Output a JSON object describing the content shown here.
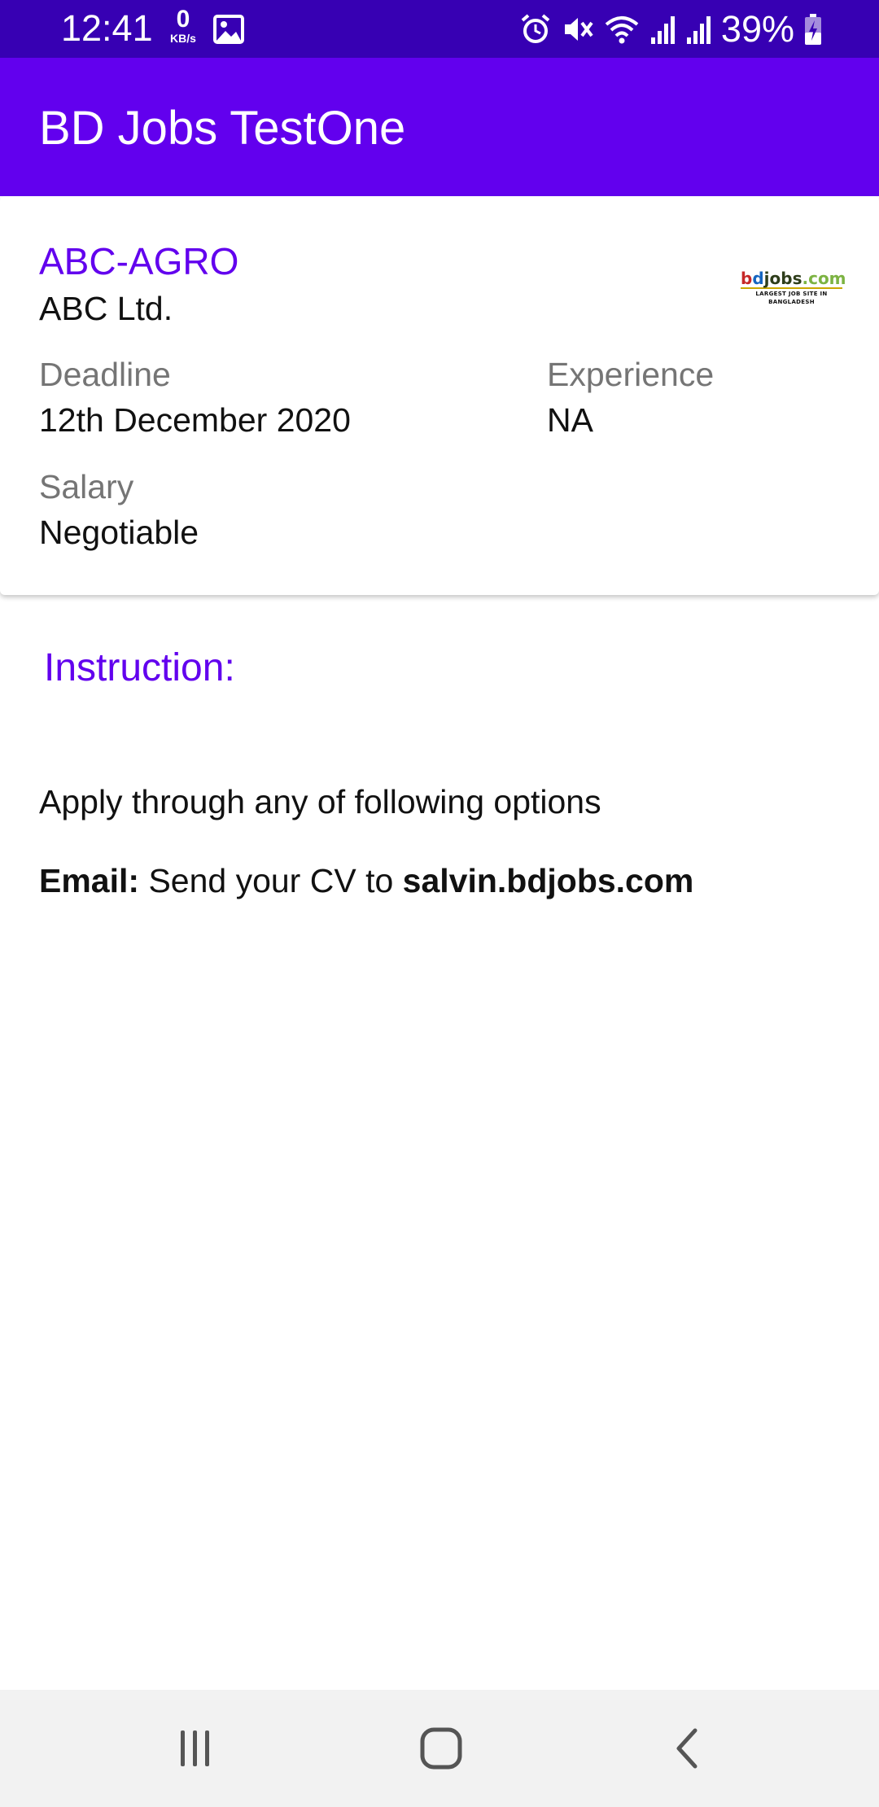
{
  "status_bar": {
    "time": "12:41",
    "net_speed_value": "0",
    "net_speed_unit": "KB/s",
    "battery_percent": "39%",
    "icons": [
      "gallery-icon",
      "alarm-icon",
      "mute-icon",
      "wifi-icon",
      "signal-icon",
      "signal-icon",
      "battery-charging-icon"
    ]
  },
  "app_bar": {
    "title": "BD Jobs TestOne",
    "color": "#6200ee",
    "status_color": "#3700b3"
  },
  "job": {
    "title": "ABC-AGRO",
    "company": "ABC Ltd.",
    "logo": {
      "b": "b",
      "d": "d",
      "rest": "jobs",
      "com": ".com",
      "tagline": "LARGEST JOB SITE IN BANGLADESH"
    },
    "deadline_label": "Deadline",
    "deadline_value": "12th December 2020",
    "experience_label": "Experience",
    "experience_value": "NA",
    "salary_label": "Salary",
    "salary_value": "Negotiable"
  },
  "instruction": {
    "heading": "Instruction:",
    "apply_text": "Apply through any of following options",
    "email_label": "Email:",
    "email_text": " Send your CV to ",
    "email_address": "salvin.bdjobs.com"
  },
  "nav_bar": {
    "icons": [
      "recents-icon",
      "home-icon",
      "back-icon"
    ]
  }
}
